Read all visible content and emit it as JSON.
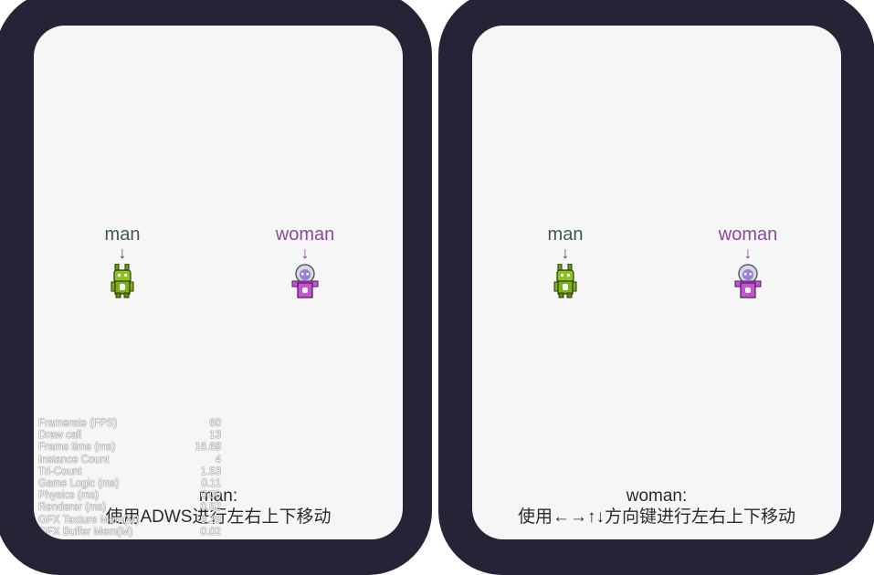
{
  "left_view": {
    "characters": [
      {
        "id": "man",
        "label": "man",
        "arrow": "↓"
      },
      {
        "id": "woman",
        "label": "woman",
        "arrow": "↓"
      }
    ],
    "instructions": {
      "title": "man:",
      "text": "使用ADWS进行左右上下移动"
    },
    "stats": [
      {
        "label": "Framerate (FPS)",
        "value": "60"
      },
      {
        "label": "Draw call",
        "value": "13"
      },
      {
        "label": "Frame time (ms)",
        "value": "16.68"
      },
      {
        "label": "Instance Count",
        "value": "4"
      },
      {
        "label": "Tri-Count",
        "value": "1.53"
      },
      {
        "label": "Game Logic (ms)",
        "value": "0.11"
      },
      {
        "label": "Physics (ms)",
        "value": "0.00"
      },
      {
        "label": "Renderer (ms)",
        "value": "0.52"
      },
      {
        "label": "GFX Texture Mem(M)",
        "value": "9.28"
      },
      {
        "label": "GFX Buffer Mem(M)",
        "value": "0.02"
      }
    ]
  },
  "right_view": {
    "characters": [
      {
        "id": "man",
        "label": "man",
        "arrow": "↓"
      },
      {
        "id": "woman",
        "label": "woman",
        "arrow": "↓"
      }
    ],
    "instructions": {
      "title": "woman:",
      "text": "使用←→↑↓方向键进行左右上下移动"
    }
  },
  "colors": {
    "frame": "#252336",
    "screen": "#f6f6f6",
    "man_label": "#3d5b48",
    "woman_label": "#8a4a98",
    "man_sprite": "#7fb01a",
    "woman_sprite": "#c653d6"
  }
}
